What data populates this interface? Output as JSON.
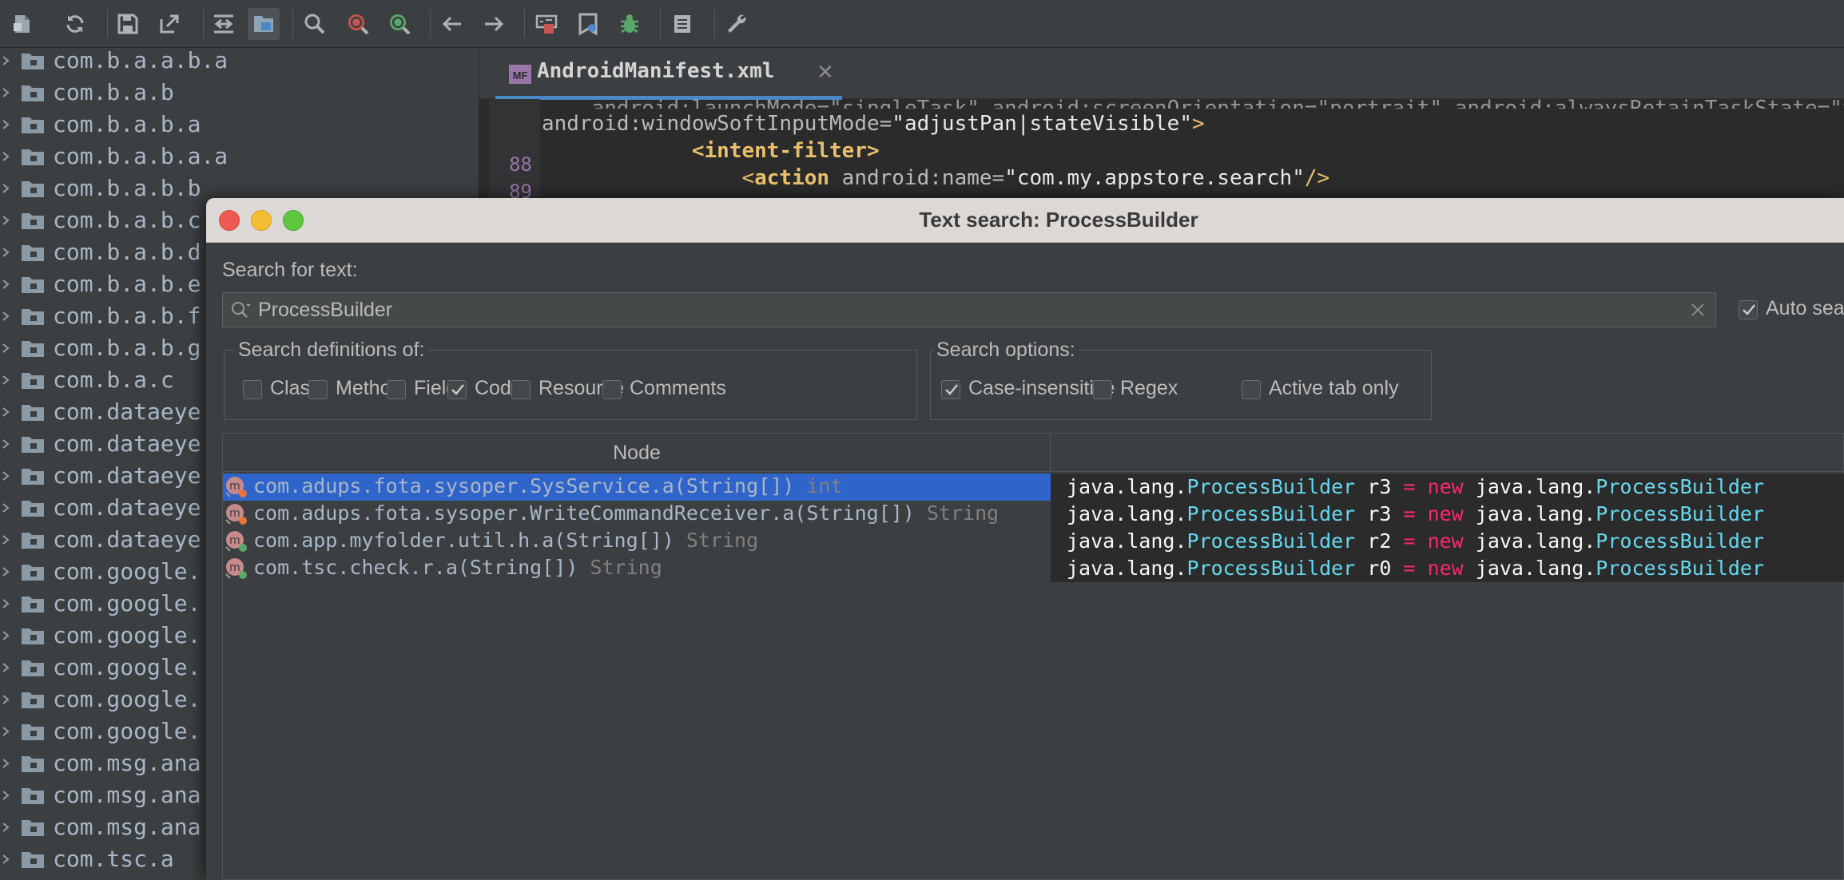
{
  "toolbar": {
    "icons": [
      "open-file-icon",
      "sync-icon",
      "save-icon",
      "export-icon",
      "flatten-icon",
      "show-tree-icon",
      "search-icon",
      "find-class-icon",
      "find-usage-icon",
      "back-icon",
      "forward-icon",
      "deobfuscate-icon",
      "log-viewer-icon",
      "debug-icon",
      "log-icon",
      "preferences-icon"
    ]
  },
  "tree": {
    "items": [
      "com.b.a.a.b.a",
      "com.b.a.b",
      "com.b.a.b.a",
      "com.b.a.b.a.a",
      "com.b.a.b.b",
      "com.b.a.b.c",
      "com.b.a.b.d",
      "com.b.a.b.e",
      "com.b.a.b.f",
      "com.b.a.b.g",
      "com.b.a.c",
      "com.dataeye",
      "com.dataeye",
      "com.dataeye",
      "com.dataeye",
      "com.dataeye",
      "com.google.",
      "com.google.",
      "com.google.",
      "com.google.",
      "com.google.",
      "com.google.",
      "com.msg.ana",
      "com.msg.ana",
      "com.msg.ana",
      "com.tsc.a"
    ]
  },
  "editor": {
    "tab_icon_text": "MF",
    "tab_label": "AndroidManifest.xml",
    "tab_close": "✕",
    "line0": "android:launchMode=\"singleTask\" android:screenOrientation=\"portrait\" android:alwaysRetainTaskState=\"true\"",
    "line1_attr": "android:windowSoftInputMode=",
    "line1_val": "\"adjustPan|stateVisible\"",
    "line1_end": ">",
    "line2_num": "88",
    "line2_indent": "            ",
    "line2_tag": "<intent-filter>",
    "line3_num": "89",
    "line3_indent": "                ",
    "line3_tag_open": "<",
    "line3_tag_name": "action",
    "line3_attr": " android:name=",
    "line3_val": "\"com.my.appstore.search\"",
    "line3_end": "/>"
  },
  "dialog": {
    "title": "Text search: ProcessBuilder",
    "search_label": "Search for text:",
    "search_value": "ProcessBuilder",
    "auto_search_label": "Auto sea",
    "auto_search_checked": true,
    "definitions_label": "Search definitions of:",
    "definitions": [
      {
        "label": "Class",
        "checked": false
      },
      {
        "label": "Method",
        "checked": false
      },
      {
        "label": "Field",
        "checked": false
      },
      {
        "label": "Code",
        "checked": true
      },
      {
        "label": "Resource",
        "checked": false
      },
      {
        "label": "Comments",
        "checked": false
      }
    ],
    "options_label": "Search options:",
    "options": [
      {
        "label": "Case-insensitive",
        "checked": true
      },
      {
        "label": "Regex",
        "checked": false
      },
      {
        "label": "Active tab only",
        "checked": false
      }
    ],
    "table": {
      "node_header": "Node",
      "code_header": "",
      "rows": [
        {
          "node": "com.adups.fota.sysoper.SysService.a(String[])",
          "type": " int",
          "selected": true,
          "pkg": "java.lang.",
          "cls": "ProcessBuilder",
          "var": " r3 ",
          "eq": "=",
          "new": " new ",
          "pkg2": "java.lang.",
          "cls2": "ProcessBuilder"
        },
        {
          "node": "com.adups.fota.sysoper.WriteCommandReceiver.a(String[])",
          "type": " String",
          "selected": false,
          "pkg": "java.lang.",
          "cls": "ProcessBuilder",
          "var": " r3 ",
          "eq": "=",
          "new": " new ",
          "pkg2": "java.lang.",
          "cls2": "ProcessBuilder"
        },
        {
          "node": "com.app.myfolder.util.h.a(String[])",
          "type": " String",
          "selected": false,
          "pkg": "java.lang.",
          "cls": "ProcessBuilder",
          "var": " r2 ",
          "eq": "=",
          "new": " new ",
          "pkg2": "java.lang.",
          "cls2": "ProcessBuilder"
        },
        {
          "node": "com.tsc.check.r.a(String[])",
          "type": " String",
          "selected": false,
          "pkg": "java.lang.",
          "cls": "ProcessBuilder",
          "var": " r0 ",
          "eq": "=",
          "new": " new ",
          "pkg2": "java.lang.",
          "cls2": "ProcessBuilder"
        }
      ]
    }
  },
  "colors": {
    "background": "#3c3f41",
    "editor_bg": "#2b2b2b",
    "selection": "#2f65ca",
    "accent_cyan": "#66d9ef",
    "accent_pink": "#f92672"
  }
}
